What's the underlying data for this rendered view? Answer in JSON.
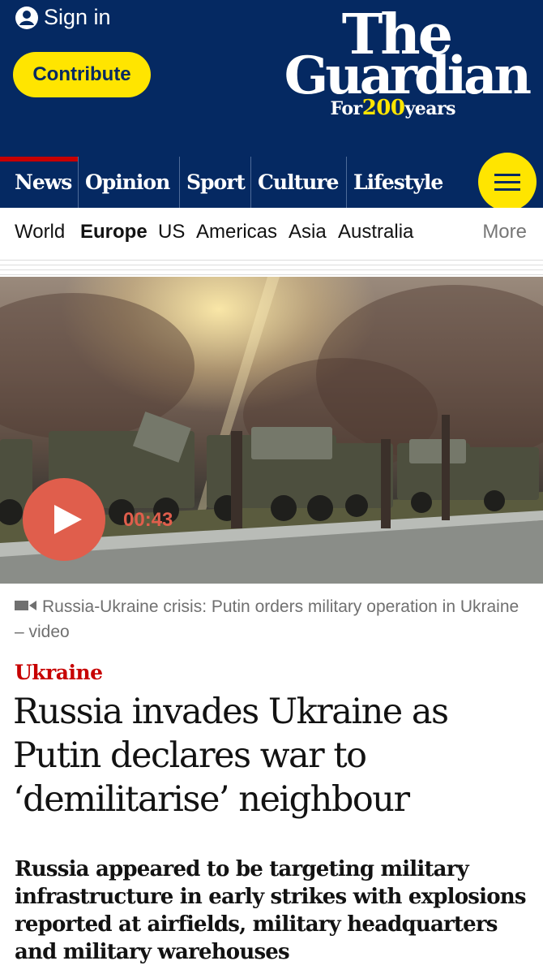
{
  "header": {
    "sign_in_label": "Sign in",
    "contribute_label": "Contribute",
    "logo": {
      "line1": "The",
      "line2": "Guardian",
      "tagline_prefix": "For",
      "tagline_number": "200",
      "tagline_suffix": "years"
    },
    "colors": {
      "brand_navy": "#052962",
      "brand_yellow": "#ffe500",
      "news_red": "#c70000"
    }
  },
  "pillars": [
    {
      "label": "News",
      "active": true
    },
    {
      "label": "Opinion",
      "active": false
    },
    {
      "label": "Sport",
      "active": false
    },
    {
      "label": "Culture",
      "active": false
    },
    {
      "label": "Lifestyle",
      "active": false
    }
  ],
  "menu_icon": "hamburger-menu-icon",
  "subnav": {
    "items": [
      {
        "label": "World",
        "selected": false
      },
      {
        "label": "Europe",
        "selected": true
      },
      {
        "label": "US",
        "selected": false
      },
      {
        "label": "Americas",
        "selected": false
      },
      {
        "label": "Asia",
        "selected": false
      },
      {
        "label": "Australia",
        "selected": false
      }
    ],
    "more_label": "More"
  },
  "video": {
    "duration": "00:43",
    "caption": "Russia-Ukraine crisis: Putin orders military operation in Ukraine – video"
  },
  "article": {
    "kicker": "Ukraine",
    "headline": "Russia invades Ukraine as Putin declares war to ‘demilitarise’ neighbour",
    "standfirst": "Russia appeared to be targeting military infrastructure in early strikes with explosions reported at airfields, military headquarters and military warehouses"
  }
}
